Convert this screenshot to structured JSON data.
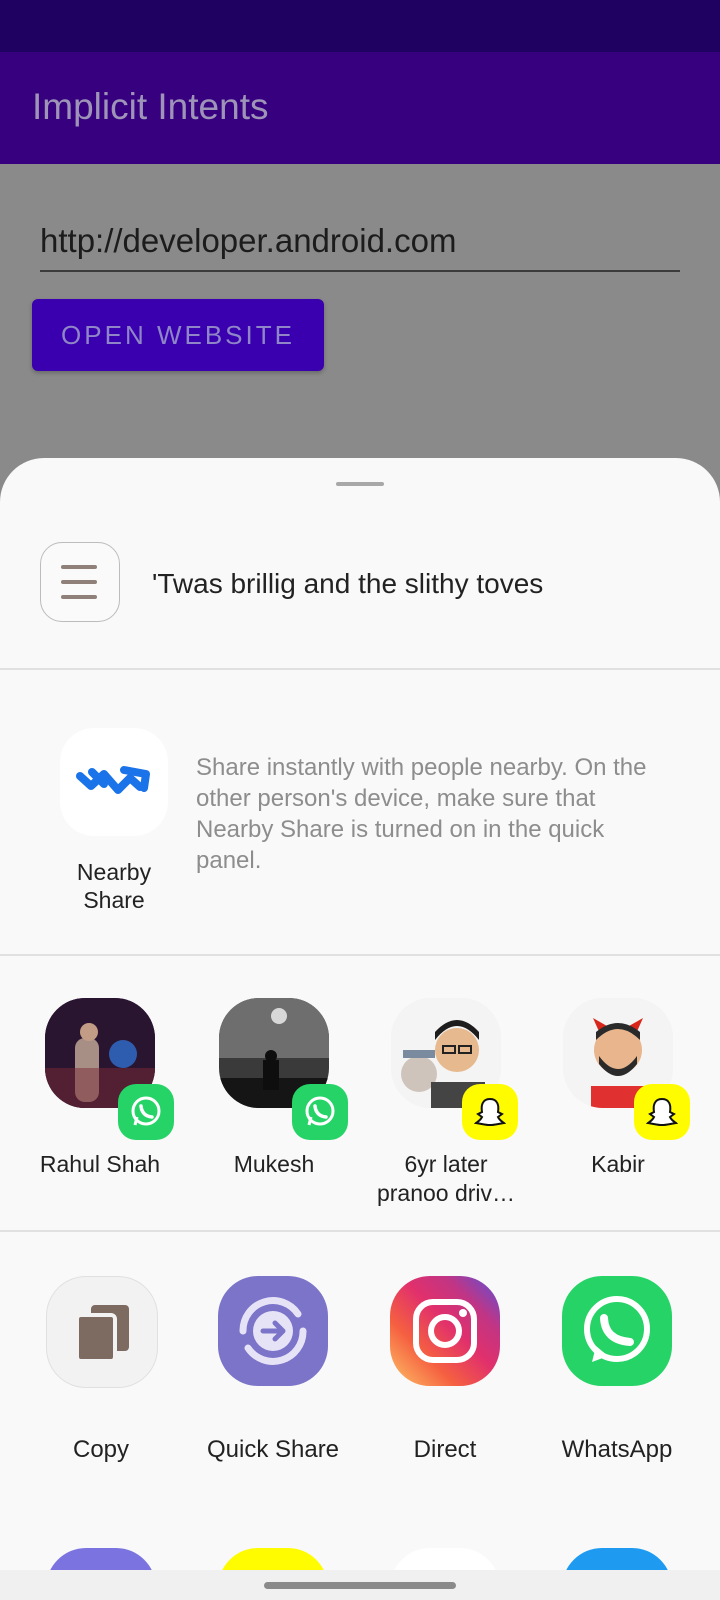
{
  "app": {
    "title": "Implicit Intents",
    "url_value": "http://developer.android.com",
    "open_button_label": "OPEN WEBSITE"
  },
  "sheet": {
    "preview_text": "'Twas brillig and the slithy toves",
    "nearby": {
      "label_line1": "Nearby",
      "label_line2": "Share",
      "description": "Share instantly with people nearby. On the other person's device, make sure that Nearby Share is turned on in the quick panel.",
      "icon": "nearby-share-icon"
    },
    "contacts": [
      {
        "name": "Rahul Shah",
        "badge": "whatsapp-icon"
      },
      {
        "name": "Mukesh",
        "badge": "whatsapp-icon"
      },
      {
        "name_line1": "6yr later",
        "name_line2": "pranoo driv…",
        "badge": "snapchat-icon"
      },
      {
        "name": "Kabir",
        "badge": "snapchat-icon"
      }
    ],
    "apps": [
      {
        "label": "Copy",
        "icon": "copy-icon"
      },
      {
        "label": "Quick Share",
        "icon": "quick-share-icon"
      },
      {
        "label": "Direct",
        "icon": "instagram-icon"
      },
      {
        "label": "WhatsApp",
        "icon": "whatsapp-icon"
      }
    ]
  },
  "colors": {
    "app_bar": "#37007f",
    "status_bar": "#1e0161",
    "button": "#3a00b0",
    "whatsapp": "#25d366",
    "snapchat": "#fffc00",
    "quick_share": "#7b74c8",
    "nearby_blue": "#1a73e8"
  }
}
